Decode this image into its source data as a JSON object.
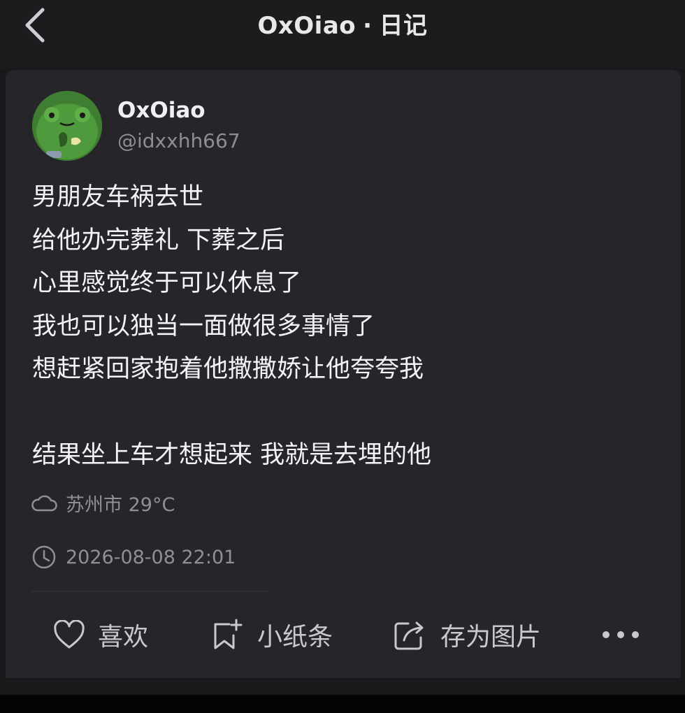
{
  "header": {
    "title_user": "OxOiao",
    "title_separator": "·",
    "title_section": "日记"
  },
  "user": {
    "name": "OxOiao",
    "handle": "@idxxhh667",
    "avatar": "green-cartoon-frog-avatar"
  },
  "post": {
    "lines": [
      "男朋友车祸去世",
      "给他办完葬礼 下葬之后",
      "心里感觉终于可以休息了",
      "我也可以独当一面做很多事情了",
      "想赶紧回家抱着他撒撒娇让他夸夸我",
      "",
      "结果坐上车才想起来 我就是去埋的他"
    ]
  },
  "meta": {
    "location": "苏州市 29°C",
    "weather_icon": "cloud-icon",
    "timestamp": "2026-08-08 22:01",
    "time_icon": "clock-icon"
  },
  "actions": {
    "like_label": "喜欢",
    "note_label": "小纸条",
    "save_label": "存为图片",
    "more_icon": "more-dots-icon"
  },
  "colors": {
    "background": "#19191c",
    "card": "#25252a",
    "text_primary": "#f4f4f6",
    "text_secondary": "#8f8f95",
    "avatar_green": "#3f7d32"
  }
}
